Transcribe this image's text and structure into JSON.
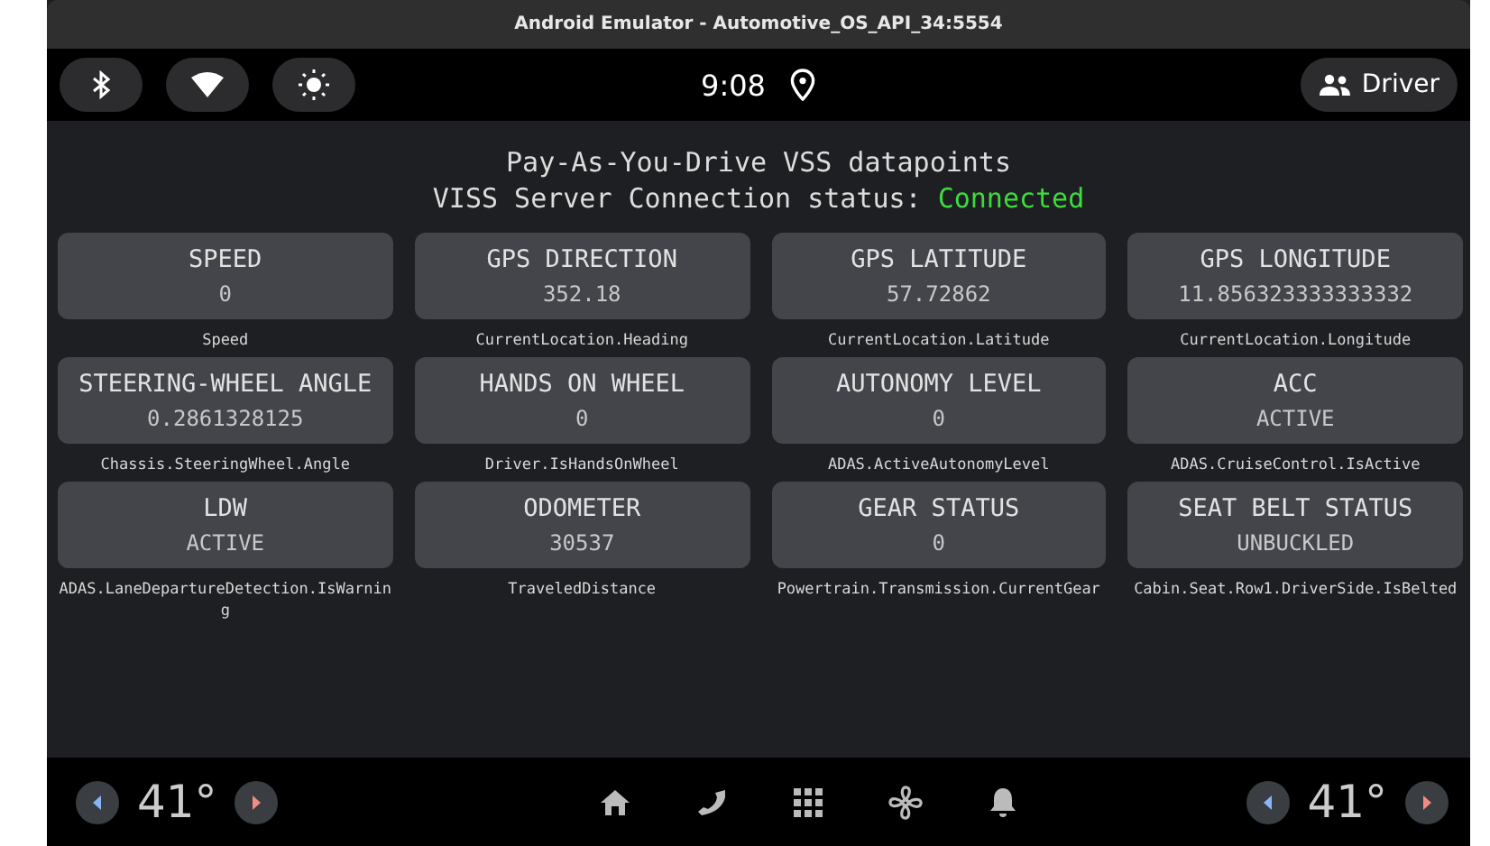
{
  "window": {
    "title": "Android Emulator - Automotive_OS_API_34:5554"
  },
  "status_bar": {
    "time": "9:08",
    "user": "Driver"
  },
  "header": {
    "title": "Pay-As-You-Drive VSS datapoints",
    "connection_label": "VISS Server Connection status:",
    "connection_status": "Connected",
    "connected": true
  },
  "cards": [
    {
      "title": "SPEED",
      "value": "0",
      "path": "Speed"
    },
    {
      "title": "GPS DIRECTION",
      "value": "352.18",
      "path": "CurrentLocation.Heading"
    },
    {
      "title": "GPS LATITUDE",
      "value": "57.72862",
      "path": "CurrentLocation.Latitude"
    },
    {
      "title": "GPS LONGITUDE",
      "value": "11.856323333333332",
      "path": "CurrentLocation.Longitude"
    },
    {
      "title": "STEERING-WHEEL ANGLE",
      "value": "0.2861328125",
      "path": "Chassis.SteeringWheel.Angle"
    },
    {
      "title": "HANDS ON WHEEL",
      "value": "0",
      "path": "Driver.IsHandsOnWheel"
    },
    {
      "title": "AUTONOMY LEVEL",
      "value": "0",
      "path": "ADAS.ActiveAutonomyLevel"
    },
    {
      "title": "ACC",
      "value": "ACTIVE",
      "path": "ADAS.CruiseControl.IsActive"
    },
    {
      "title": "LDW",
      "value": "ACTIVE",
      "path": "ADAS.LaneDepartureDetection.IsWarning"
    },
    {
      "title": "ODOMETER",
      "value": "30537",
      "path": "TraveledDistance"
    },
    {
      "title": "GEAR STATUS",
      "value": "0",
      "path": "Powertrain.Transmission.CurrentGear"
    },
    {
      "title": "SEAT BELT STATUS",
      "value": "UNBUCKLED",
      "path": "Cabin.Seat.Row1.DriverSide.IsBelted"
    }
  ],
  "nav_bar": {
    "left_temperature": "41°",
    "right_temperature": "41°"
  }
}
